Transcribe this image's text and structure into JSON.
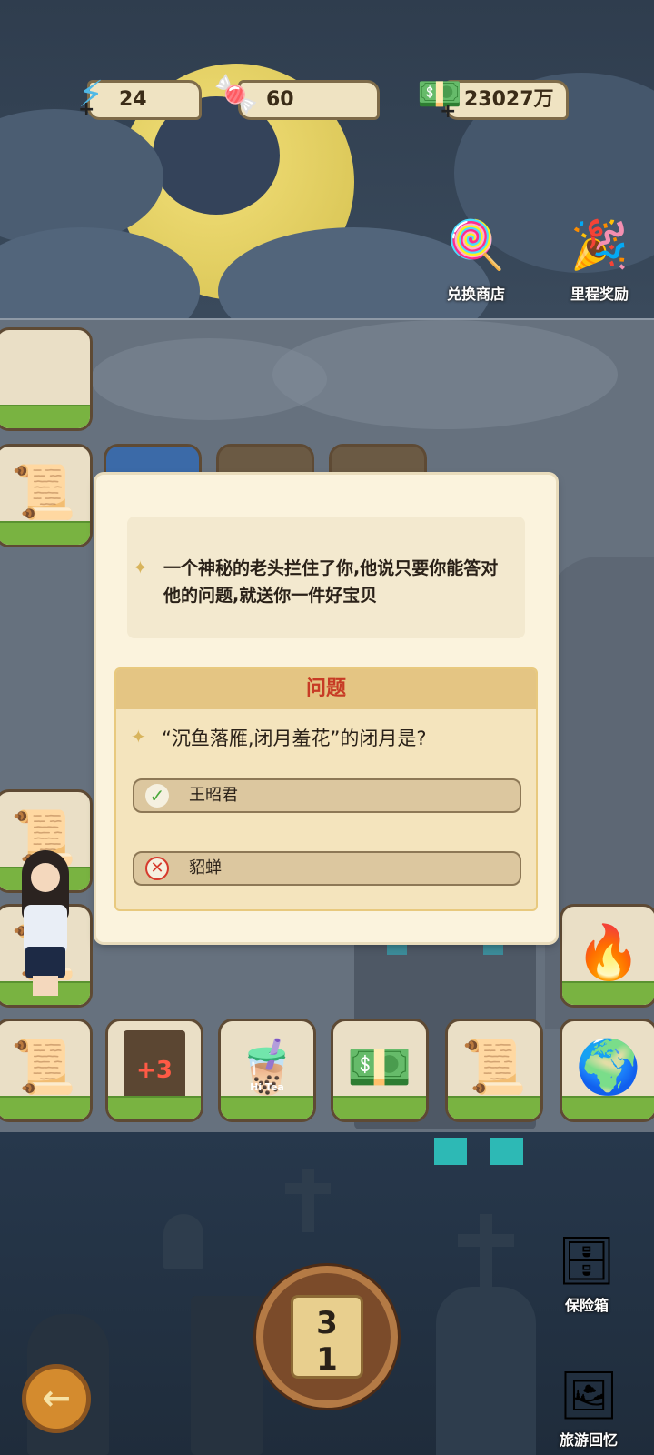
{
  "resources": [
    {
      "icon": "⚡",
      "name": "energy",
      "value": "24"
    },
    {
      "icon": "🍬",
      "name": "candy",
      "value": "60"
    },
    {
      "icon": "💵",
      "name": "cash",
      "value": "23027万"
    }
  ],
  "top_buttons": {
    "exchange_shop": {
      "icon": "gumball-machine-icon",
      "label": "兑换商店"
    },
    "milestone_rewards": {
      "icon": "party-popper-icon",
      "label": "里程奖励"
    }
  },
  "dialog": {
    "story": "一个神秘的老头拦住了你,他说只要你能答对他的问题,就送你一件好宝贝",
    "question_title": "问题",
    "question": "“沉鱼落雁,闭月羞花”的闭月是?",
    "answers": [
      {
        "text": "王昭君",
        "state": "correct"
      },
      {
        "text": "貂蝉",
        "state": "wrong"
      }
    ]
  },
  "dice": {
    "top": "3",
    "bottom": "1"
  },
  "bottom_buttons": {
    "safe": {
      "icon": "safe-icon",
      "label": "保险箱"
    },
    "travel_memories": {
      "icon": "photo-album-icon",
      "label": "旅游回忆"
    }
  },
  "tile_labels": {
    "plus_three": "+3",
    "hi_tea": "Hi Tea"
  }
}
